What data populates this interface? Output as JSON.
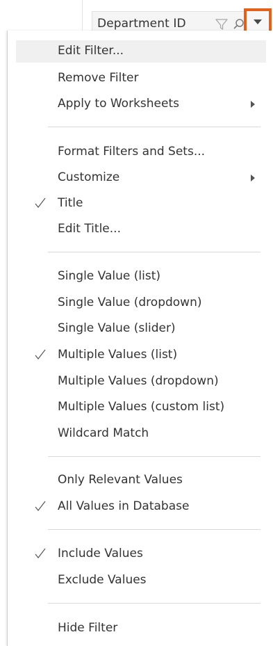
{
  "filter_card": {
    "title": "Department ID",
    "icons": [
      "filter-icon",
      "search-icon",
      "dropdown-arrow-icon"
    ],
    "highlight_color": "#e5611a"
  },
  "menu": {
    "edit_filter": "Edit Filter...",
    "remove_filter": "Remove Filter",
    "apply_to_worksheets": "Apply to Worksheets",
    "format_filters_and_sets": "Format Filters and Sets...",
    "customize": "Customize",
    "title": "Title",
    "edit_title": "Edit Title...",
    "single_value_list": "Single Value (list)",
    "single_value_dropdown": "Single Value (dropdown)",
    "single_value_slider": "Single Value (slider)",
    "multiple_values_list": "Multiple Values (list)",
    "multiple_values_dropdown": "Multiple Values (dropdown)",
    "multiple_values_custom_list": "Multiple Values (custom list)",
    "wildcard_match": "Wildcard Match",
    "only_relevant_values": "Only Relevant Values",
    "all_values_in_database": "All Values in Database",
    "include_values": "Include Values",
    "exclude_values": "Exclude Values",
    "hide_filter": "Hide Filter",
    "checked_items": [
      "Title",
      "Multiple Values (list)",
      "All Values in Database",
      "Include Values"
    ],
    "highlighted_item": "Edit Filter..."
  }
}
